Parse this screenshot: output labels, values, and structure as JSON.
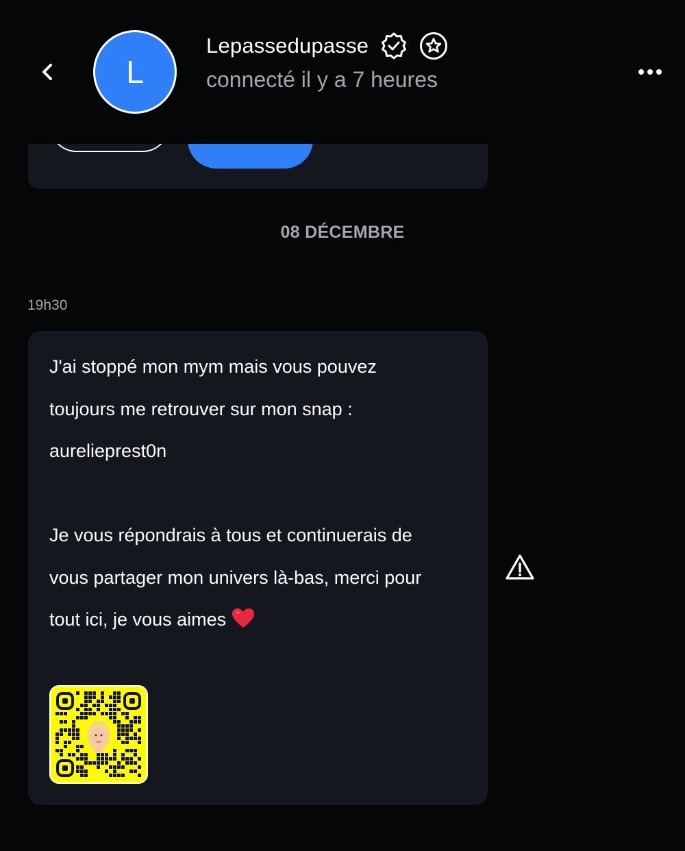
{
  "header": {
    "username": "Lepassedupasse",
    "avatar_letter": "L",
    "status": "connecté il y a 7 heures",
    "icons": {
      "back": "chevron-left-icon",
      "verified": "verified-badge-icon",
      "favorite": "star-circle-icon",
      "more": "more-horizontal-icon"
    }
  },
  "conversation": {
    "date_separator": "08 DÉCEMBRE",
    "message": {
      "time": "19h30",
      "paragraph1_lines": [
        "J'ai stoppé mon mym mais vous pouvez",
        "toujours me retrouver sur mon snap :",
        "aurelieprest0n"
      ],
      "paragraph2_lines": [
        "Je vous répondrais à tous et continuerais de",
        "vous partager mon univers là-bas, merci pour",
        "tout ici, je vous aimes"
      ],
      "emoji": "red-heart",
      "attachment": "snapcode-qr"
    },
    "report_icon": "warning-triangle-icon"
  },
  "colors": {
    "background": "#050608",
    "card": "#14171e",
    "accent_blue": "#2f80f8",
    "muted_text": "#a5a7ad",
    "heart": "#e8283f",
    "snap_yellow": "#fffc00"
  }
}
